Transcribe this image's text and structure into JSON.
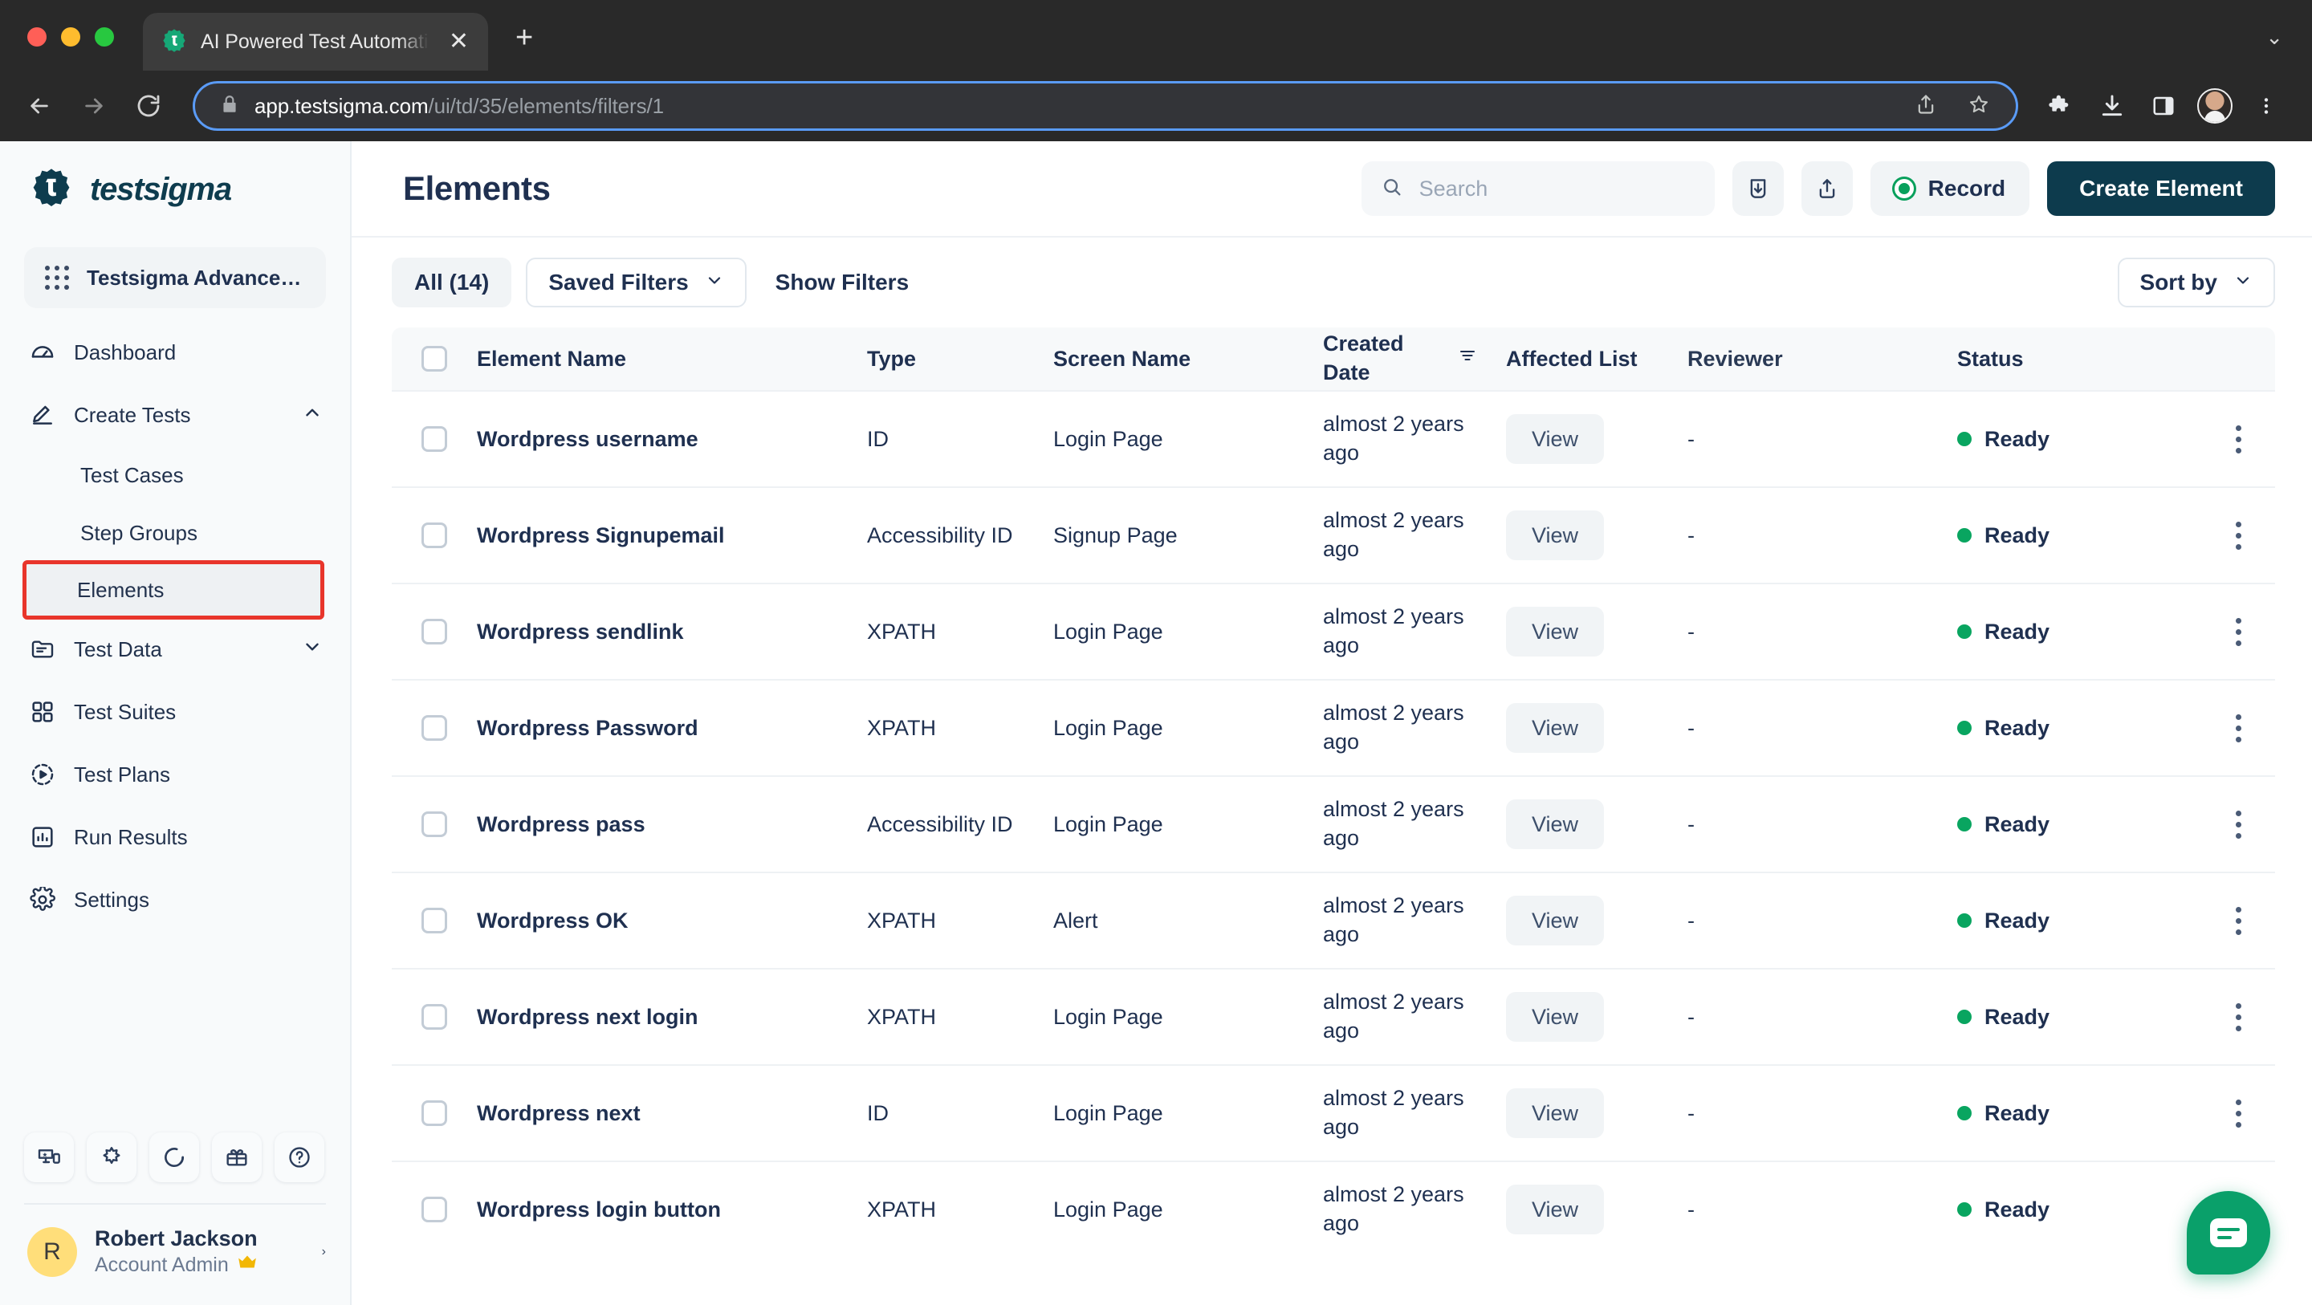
{
  "browser": {
    "tab": {
      "title": "AI Powered Test Automation P",
      "favicon": "testsigma-favicon"
    },
    "new_tab_label": "+",
    "tab_list_chevron": "⌄",
    "url_host": "app.testsigma.com",
    "url_path": "/ui/td/35/elements/filters/1",
    "back_label": "←",
    "forward_label": "→",
    "reload_label": "↻",
    "close_tab_label": "✕"
  },
  "sidebar": {
    "brand": "testsigma",
    "workspace": "Testsigma Advanced...",
    "items": [
      {
        "label": "Dashboard",
        "icon": "dashboard-icon",
        "type": "link"
      },
      {
        "label": "Create Tests",
        "icon": "pencil-icon",
        "type": "group",
        "chevron": "⌃",
        "expanded": true
      },
      {
        "label": "Test Cases",
        "icon": "",
        "type": "sub"
      },
      {
        "label": "Step Groups",
        "icon": "",
        "type": "sub"
      },
      {
        "label": "Elements",
        "icon": "",
        "type": "sub",
        "active": true
      },
      {
        "label": "Test Data",
        "icon": "folder-icon",
        "type": "group",
        "chevron": "⌄",
        "expanded": false
      },
      {
        "label": "Test Suites",
        "icon": "grid-squares-icon",
        "type": "link"
      },
      {
        "label": "Test Plans",
        "icon": "play-circle-icon",
        "type": "link"
      },
      {
        "label": "Run Results",
        "icon": "bar-chart-icon",
        "type": "link"
      },
      {
        "label": "Settings",
        "icon": "gear-icon",
        "type": "link"
      }
    ],
    "quick_actions": [
      {
        "icon": "devices-icon"
      },
      {
        "icon": "puzzle-icon"
      },
      {
        "icon": "progress-circle-icon"
      },
      {
        "icon": "gift-icon"
      },
      {
        "icon": "help-circle-icon"
      }
    ],
    "profile": {
      "initial": "R",
      "name": "Robert Jackson",
      "role": "Account Admin",
      "crown": "♛",
      "chevron": "›"
    }
  },
  "header": {
    "title": "Elements",
    "search_placeholder": "Search",
    "download_icon": "download-box-icon",
    "share_icon": "share-upload-icon",
    "record_label": "Record",
    "create_label": "Create Element"
  },
  "filters": {
    "all_label": "All (14)",
    "saved_filters_label": "Saved Filters",
    "saved_filters_chevron": "⌄",
    "show_filters_label": "Show Filters",
    "sort_by_label": "Sort by",
    "sort_by_chevron": "⌄"
  },
  "table": {
    "columns": [
      "Element Name",
      "Type",
      "Screen Name",
      "Created Date",
      "Affected List",
      "Reviewer",
      "Status"
    ],
    "sort_column": "Created Date",
    "rows": [
      {
        "name": "Wordpress username",
        "type": "ID",
        "screen": "Login Page",
        "created": "almost 2 years ago",
        "affected": "View",
        "reviewer": "-",
        "status": "Ready"
      },
      {
        "name": "Wordpress Signupemail",
        "type": "Accessibility ID",
        "screen": "Signup Page",
        "created": "almost 2 years ago",
        "affected": "View",
        "reviewer": "-",
        "status": "Ready"
      },
      {
        "name": "Wordpress sendlink",
        "type": "XPATH",
        "screen": "Login Page",
        "created": "almost 2 years ago",
        "affected": "View",
        "reviewer": "-",
        "status": "Ready"
      },
      {
        "name": "Wordpress Password",
        "type": "XPATH",
        "screen": "Login Page",
        "created": "almost 2 years ago",
        "affected": "View",
        "reviewer": "-",
        "status": "Ready"
      },
      {
        "name": "Wordpress pass",
        "type": "Accessibility ID",
        "screen": "Login Page",
        "created": "almost 2 years ago",
        "affected": "View",
        "reviewer": "-",
        "status": "Ready"
      },
      {
        "name": "Wordpress OK",
        "type": "XPATH",
        "screen": "Alert",
        "created": "almost 2 years ago",
        "affected": "View",
        "reviewer": "-",
        "status": "Ready"
      },
      {
        "name": "Wordpress next login",
        "type": "XPATH",
        "screen": "Login Page",
        "created": "almost 2 years ago",
        "affected": "View",
        "reviewer": "-",
        "status": "Ready"
      },
      {
        "name": "Wordpress next",
        "type": "ID",
        "screen": "Login Page",
        "created": "almost 2 years ago",
        "affected": "View",
        "reviewer": "-",
        "status": "Ready"
      },
      {
        "name": "Wordpress login button",
        "type": "XPATH",
        "screen": "Login Page",
        "created": "almost 2 years ago",
        "affected": "View",
        "reviewer": "-",
        "status": "Ready"
      }
    ]
  },
  "chat": {
    "icon": "chat-bubble-icon"
  },
  "colors": {
    "brand_dark": "#0d3b4d",
    "accent_green": "#09a560",
    "highlight_red": "#e8352b",
    "text_primary": "#1f3050",
    "sidebar_bg": "#f8fafb"
  }
}
